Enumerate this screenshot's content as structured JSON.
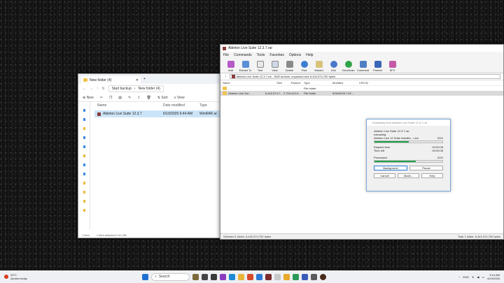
{
  "explorer": {
    "tab_title": "New folder (4)",
    "breadcrumb_start": "Start backup",
    "breadcrumb_folder": "New folder (4)",
    "cmd_new": "New",
    "cmd_sort": "Sort",
    "cmd_view": "View",
    "columns": {
      "name": "Name",
      "date": "Date modified",
      "type": "Type"
    },
    "rows": [
      {
        "name": "Ableton Live Suite 12.3.7",
        "date": "6/10/2026 6:44 AM",
        "type": "WinRAR ar"
      }
    ],
    "status_items": "1 item",
    "status_selected": "1 item selected  2.44 GB"
  },
  "winrar": {
    "title": "Ableton Live Suite 12.3.7.rar",
    "menu": [
      "File",
      "Commands",
      "Tools",
      "Favorites",
      "Options",
      "Help"
    ],
    "toolbar": [
      "Add",
      "Extract To",
      "Test",
      "View",
      "Delete",
      "Find",
      "Wizard",
      "Info",
      "VirusScan",
      "Comment",
      "Protect",
      "SFX"
    ],
    "path": "Ableton Live Suite 12.3.7.rar - RAR archive, unpacked size 6,442,574,752 bytes",
    "columns": {
      "name": "Name",
      "size": "Size",
      "packed": "Packed",
      "type": "Type",
      "modified": "Modified",
      "crc": "CRC32"
    },
    "rows": [
      {
        "name": "..",
        "size": "",
        "packed": "",
        "type": "File folder",
        "modified": "",
        "crc": ""
      },
      {
        "name": "Ableton Live Sui...",
        "size": "6,442,574,7...",
        "packed": "2,704,412,9...",
        "type": "File folder",
        "modified": "5/30/2026 7:25 ...",
        "crc": ""
      }
    ],
    "status_left": "Selected 1 folder, 6,442,574,752 bytes",
    "status_right": "Total 1 folder, 6,442,574,752 bytes"
  },
  "extract_dialog": {
    "title": "Extracting from Ableton Live Suite 12.3.7.rar",
    "archive": "Ableton Live Suite 12.3.7.rar",
    "action": "extracting",
    "file": "Ableton Live 12 Suite Installer - Live",
    "file_percent": "51%",
    "file_progress": 0.51,
    "elapsed_label": "Elapsed time",
    "elapsed_value": "00:00:08",
    "time_left_label": "Time left",
    "time_left_value": "00:00:06",
    "processed_label": "Processed",
    "processed_percent": "61%",
    "processed_progress": 0.61,
    "buttons": {
      "background": "Background",
      "pause": "Pause",
      "cancel": "Cancel",
      "mode": "Mode...",
      "help": "Help"
    }
  },
  "taskbar": {
    "temperature": "29°C",
    "weather": "Quotes today",
    "search": "Search",
    "lang": "ENG",
    "time": "9:13 AM",
    "date": "6/10/2026"
  }
}
